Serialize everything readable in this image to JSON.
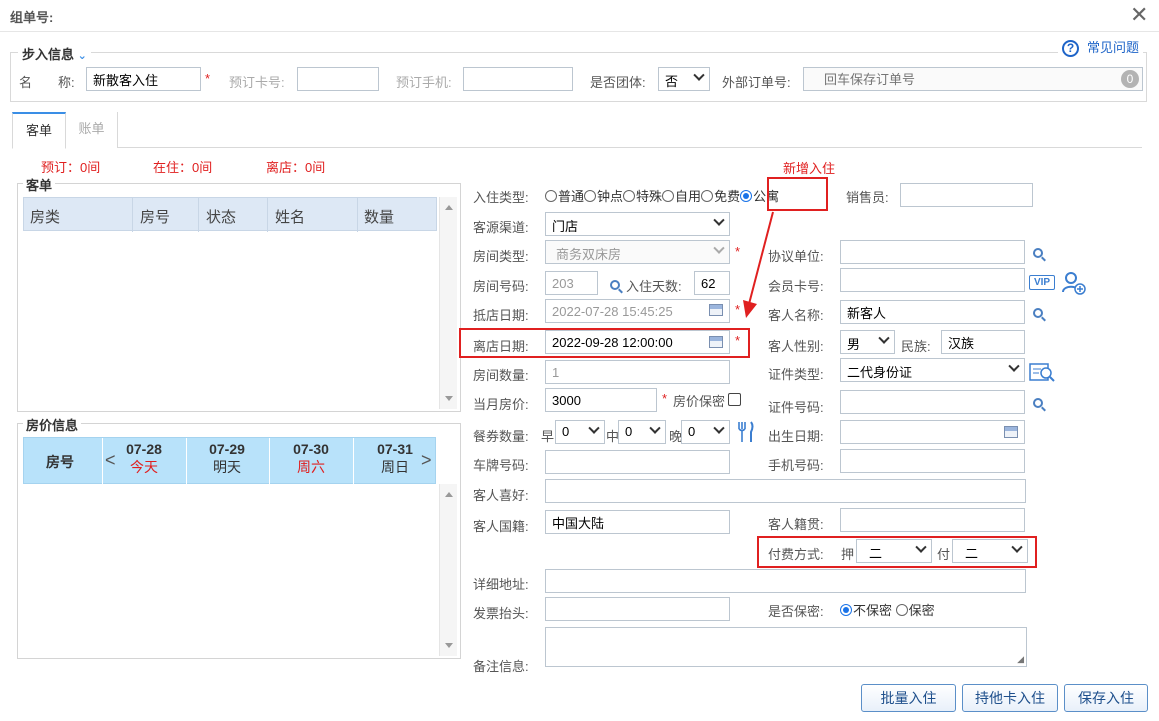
{
  "dialog": {
    "title": "组单号:",
    "close_icon": "close-icon"
  },
  "step": {
    "title": "步入信息",
    "help": "常见问题"
  },
  "top_row": {
    "name_label": "名　　称:",
    "name_value": "新散客入住",
    "card_label": "预订卡号:",
    "phone_label": "预订手机:",
    "group_label": "是否团体:",
    "group_value": "否",
    "ext_order_label": "外部订单号:",
    "ext_order_placeholder": "回车保存订单号",
    "ext_badge": "0"
  },
  "tabs": [
    "客单",
    "账单"
  ],
  "summary": {
    "reserved": "预订：0间",
    "in_house": "在住：0间",
    "departed": "离店：0间"
  },
  "guest_list": {
    "title": "客单",
    "columns": [
      "房类",
      "房号",
      "状态",
      "姓名",
      "数量"
    ]
  },
  "price_info": {
    "title": "房价信息",
    "room_col": "房号",
    "days": [
      {
        "date": "07-28",
        "label": "今天",
        "red": true
      },
      {
        "date": "07-29",
        "label": "明天",
        "red": false
      },
      {
        "date": "07-30",
        "label": "周六",
        "red": true
      },
      {
        "date": "07-31",
        "label": "周日",
        "red": false
      }
    ]
  },
  "annotation": "新增入住",
  "form": {
    "checkin_type_label": "入住类型:",
    "checkin_types": [
      "普通",
      "钟点",
      "特殊",
      "自用",
      "免费",
      "公寓"
    ],
    "seller_label": "销售员:",
    "source_label": "客源渠道:",
    "source_value": "门店",
    "room_type_label": "房间类型:",
    "room_type_value": "商务双床房",
    "agreement_label": "协议单位:",
    "room_no_label": "房间号码:",
    "room_no_value": "203",
    "days_label": "入住天数:",
    "days_value": "62",
    "member_label": "会员卡号:",
    "vip": "VIP",
    "arrive_label": "抵店日期:",
    "arrive_value": "2022-07-28 15:45:25",
    "guest_name_label": "客人名称:",
    "guest_name_value": "新客人",
    "depart_label": "离店日期:",
    "depart_value": "2022-09-28 12:00:00",
    "gender_label": "客人性别:",
    "gender_value": "男",
    "ethnic_label": "民族:",
    "ethnic_value": "汉族",
    "room_count_label": "房间数量:",
    "room_count_value": "1",
    "id_type_label": "证件类型:",
    "id_type_value": "二代身份证",
    "monthly_price_label": "当月房价:",
    "monthly_price_value": "3000",
    "price_secret_label": "房价保密",
    "id_no_label": "证件号码:",
    "meal_label": "餐券数量:",
    "meal_b_label": "早",
    "meal_b": "0",
    "meal_l_label": "中",
    "meal_l": "0",
    "meal_d_label": "晚",
    "meal_d": "0",
    "birth_label": "出生日期:",
    "plate_label": "车牌号码:",
    "mobile_label": "手机号码:",
    "hobby_label": "客人喜好:",
    "nationality_label": "客人国籍:",
    "nationality_value": "中国大陆",
    "native_label": "客人籍贯:",
    "payment_label": "付费方式:",
    "deposit_label": "押",
    "deposit_value": "二",
    "pay_label": "付",
    "pay_value": "二",
    "address_label": "详细地址:",
    "invoice_label": "发票抬头:",
    "secret_label": "是否保密:",
    "secret_no": "不保密",
    "secret_yes": "保密",
    "remark_label": "备注信息:"
  },
  "buttons": {
    "batch": "批量入住",
    "other_card": "持他卡入住",
    "save": "保存入住"
  },
  "colors": {
    "accent": "#1a73e8",
    "red": "#e02020",
    "header_blue": "#b8e2fa"
  }
}
